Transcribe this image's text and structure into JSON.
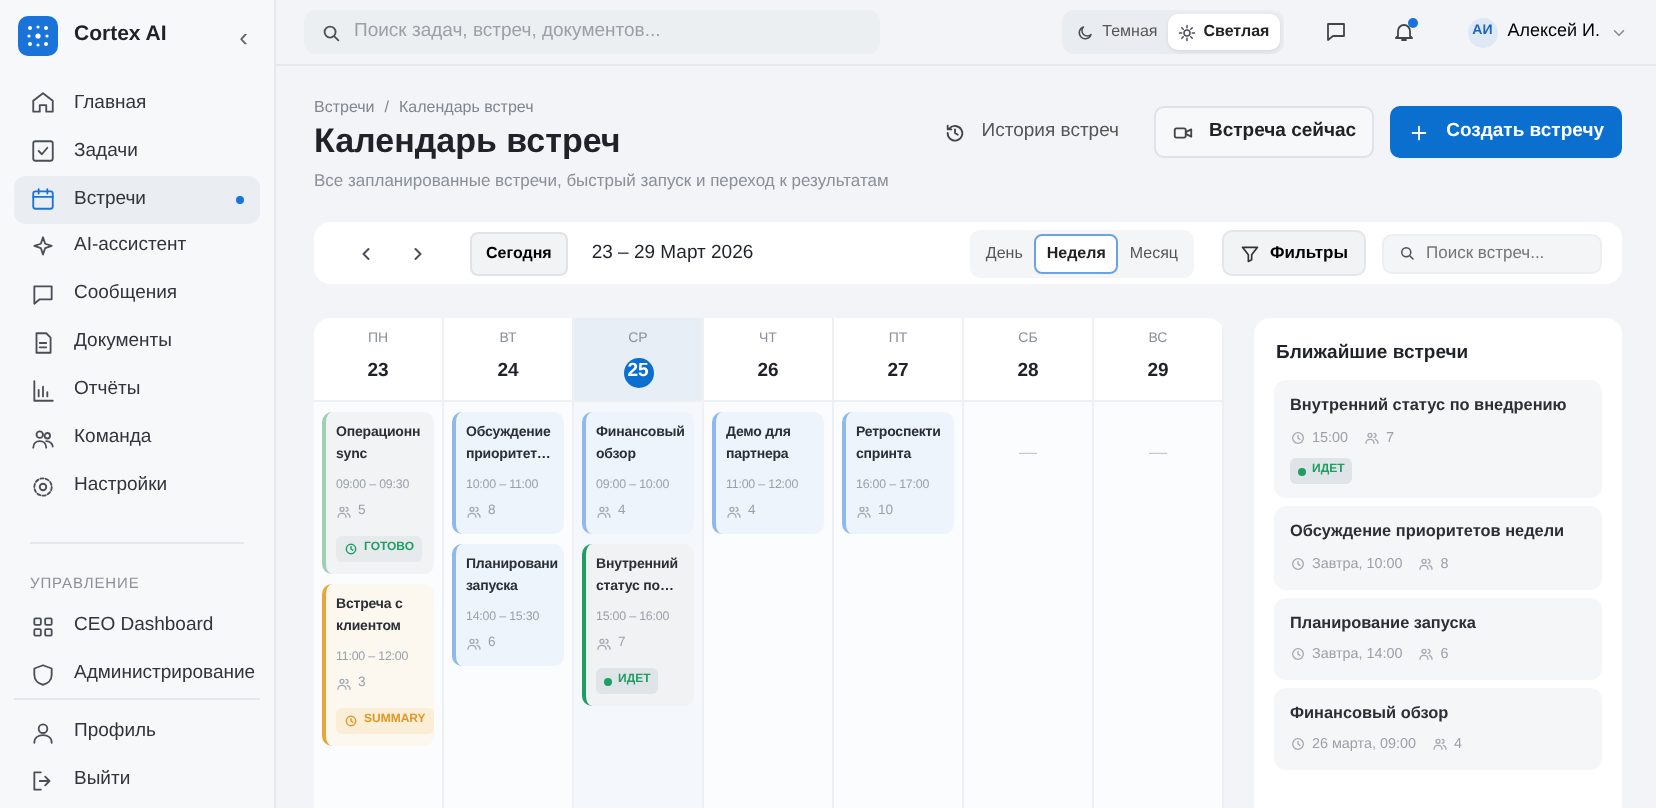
{
  "sidebar": {
    "brand": "Cortex AI",
    "collapse": "‹",
    "items": [
      {
        "label": "Главная",
        "selected": false
      },
      {
        "label": "Задачи",
        "selected": false
      },
      {
        "label": "Встречи",
        "selected": true
      },
      {
        "label": "AI-ассистент",
        "selected": false
      },
      {
        "label": "Сообщения",
        "selected": false
      },
      {
        "label": "Документы",
        "selected": false
      },
      {
        "label": "Отчёты",
        "selected": false
      },
      {
        "label": "Команда",
        "selected": false
      },
      {
        "label": "Настройки",
        "selected": false
      }
    ],
    "section_label": "УПРАВЛЕНИЕ",
    "section_items": [
      {
        "label": "CEO Dashboard",
        "selected": false
      },
      {
        "label": "Администрирование",
        "selected": false
      }
    ],
    "footer_items": [
      {
        "label": "Профиль"
      },
      {
        "label": "Выйти"
      }
    ]
  },
  "topbar": {
    "search": {
      "placeholder": "Поиск задач, встреч, документов..."
    },
    "theme_options": [
      {
        "label": "Темная",
        "selected": false
      },
      {
        "label": "Светлая",
        "selected": true
      }
    ],
    "notifications_unread": true,
    "user": {
      "initials": "АИ",
      "name": "Алексей И."
    }
  },
  "page": {
    "breadcrumb": [
      "Встречи",
      "/",
      "Календарь встреч"
    ],
    "title": "Календарь встреч",
    "subtitle": "Все запланированные встречи, быстрый запуск и переход к результатам",
    "actions": [
      {
        "kind": "link",
        "label": "История встреч"
      },
      {
        "kind": "outline",
        "label": "Встреча сейчас"
      },
      {
        "kind": "primary",
        "label": "Создать встречу"
      }
    ]
  },
  "toolbar": {
    "today": "Сегодня",
    "range": "23 – 29 Март 2026",
    "views": [
      {
        "label": "День",
        "selected": false
      },
      {
        "label": "Неделя",
        "selected": true
      },
      {
        "label": "Месяц",
        "selected": false
      }
    ],
    "filters": "Фильтры",
    "search": {
      "placeholder": "Поиск встреч..."
    }
  },
  "week": [
    {
      "dow": "ПН",
      "date": "23",
      "today": false,
      "events": [
        {
          "title": "Операционн sync",
          "time": "09:00 – 09:30",
          "people": "5",
          "color": "#9fd0b6",
          "badge": {
            "kind": "done",
            "label": "ГОТОВО"
          }
        },
        {
          "title": "Встреча с клиентом",
          "time": "11:00 – 12:00",
          "people": "3",
          "color": "#e9a53a",
          "badge": {
            "kind": "summary",
            "label": "SUMMARY"
          }
        }
      ]
    },
    {
      "dow": "ВТ",
      "date": "24",
      "today": false,
      "events": [
        {
          "title": "Обсуждение приоритет…",
          "time": "10:00 – 11:00",
          "people": "8",
          "color": "#8fb9ea"
        },
        {
          "title": "Планировани запуска",
          "time": "14:00 – 15:30",
          "people": "6",
          "color": "#8fb9ea"
        }
      ]
    },
    {
      "dow": "СР",
      "date": "25",
      "today": true,
      "events": [
        {
          "title": "Финансовый обзор",
          "time": "09:00 – 10:00",
          "people": "4",
          "color": "#8fb9ea"
        },
        {
          "title": "Внутренний статус по…",
          "time": "15:00 – 16:00",
          "people": "7",
          "color": "#1f9d62",
          "badge": {
            "kind": "live",
            "label": "ИДЕТ"
          }
        }
      ]
    },
    {
      "dow": "ЧТ",
      "date": "26",
      "today": false,
      "events": [
        {
          "title": "Демо для партнера",
          "time": "11:00 – 12:00",
          "people": "4",
          "color": "#8fb9ea"
        }
      ]
    },
    {
      "dow": "ПТ",
      "date": "27",
      "today": false,
      "events": [
        {
          "title": "Ретроспекти спринта",
          "time": "16:00 – 17:00",
          "people": "10",
          "color": "#8fb9ea"
        }
      ]
    },
    {
      "dow": "СБ",
      "date": "28",
      "today": false,
      "empty": "—"
    },
    {
      "dow": "ВС",
      "date": "29",
      "today": false,
      "empty": "—"
    }
  ],
  "upcoming": {
    "title": "Ближайшие встречи",
    "items": [
      {
        "title": "Внутренний статус по внедрению",
        "when": "15:00",
        "people": "7",
        "badge": {
          "kind": "live",
          "label": "ИДЕТ"
        }
      },
      {
        "title": "Обсуждение приоритетов недели",
        "when": "Завтра, 10:00",
        "people": "8"
      },
      {
        "title": "Планирование запуска",
        "when": "Завтра, 14:00",
        "people": "6"
      },
      {
        "title": "Финансовый обзор",
        "when": "26 марта, 09:00",
        "people": "4"
      }
    ]
  }
}
